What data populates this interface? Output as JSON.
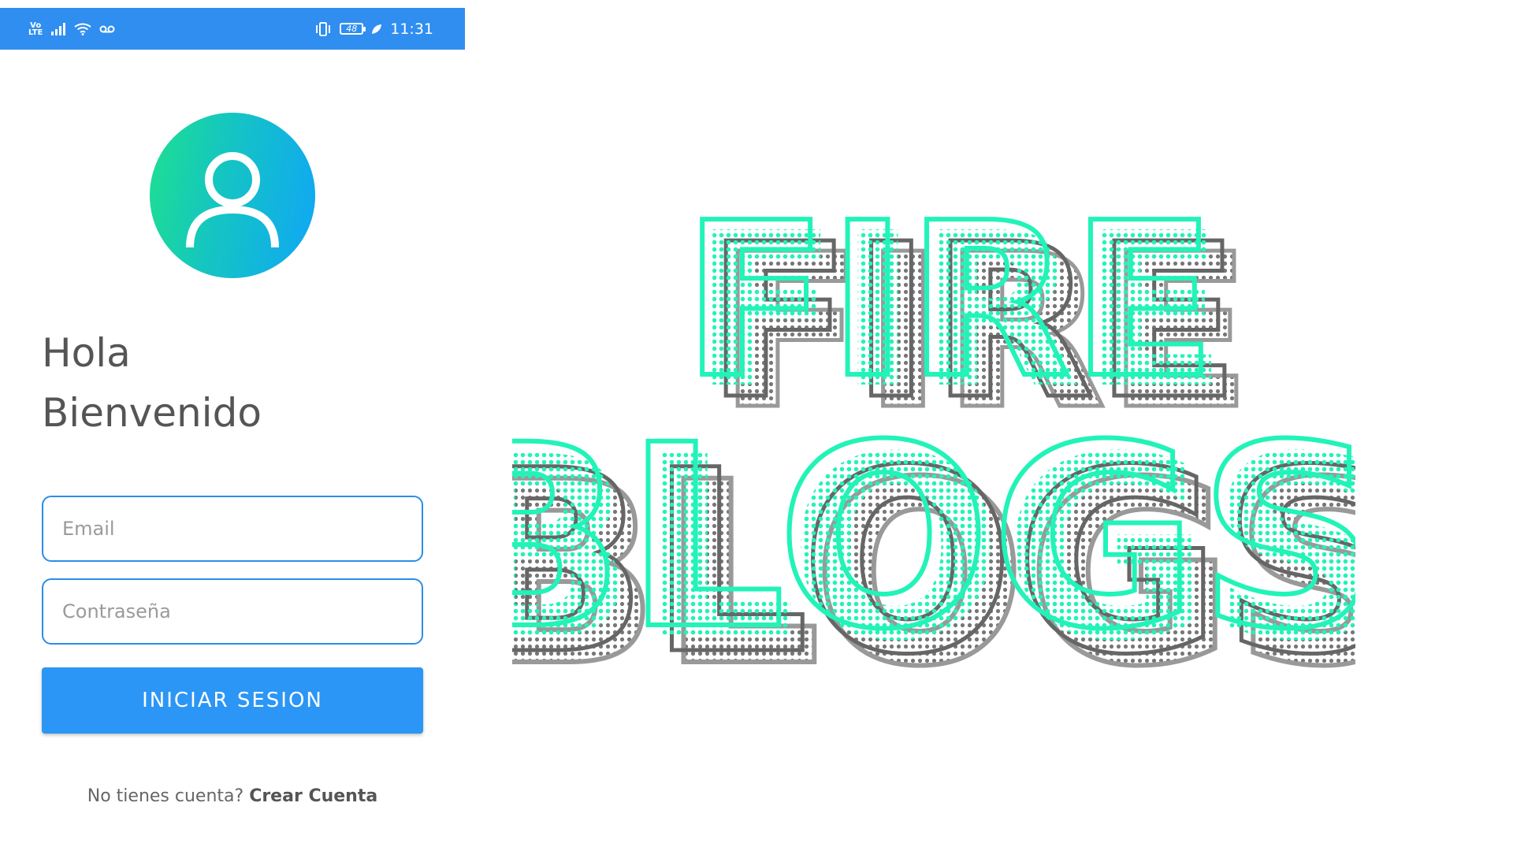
{
  "status_bar": {
    "network_label": "Vo\nLTE",
    "battery_level": "48",
    "time": "11:31"
  },
  "app": {
    "greeting_line1": "Hola",
    "greeting_line2": "Bienvenido",
    "email_placeholder": "Email",
    "password_placeholder": "Contraseña",
    "login_button": "INICIAR SESION",
    "no_account_text": "No tienes cuenta?",
    "create_account_link": "Crear Cuenta"
  },
  "logo": {
    "line1": "FIRE",
    "line2": "BLOGS"
  },
  "colors": {
    "status_bar": "#2f8ef0",
    "primary_button": "#2b96f5",
    "field_border": "#2b8ee6",
    "logo_accent": "#22f3b8",
    "avatar_gradient_start": "#1ee08f",
    "avatar_gradient_end": "#10a6f6"
  },
  "icons": [
    "volte-icon",
    "signal-icon",
    "wifi-icon",
    "voicemail-icon",
    "vibrate-icon",
    "battery-icon",
    "leaf-icon",
    "user-avatar-icon"
  ]
}
